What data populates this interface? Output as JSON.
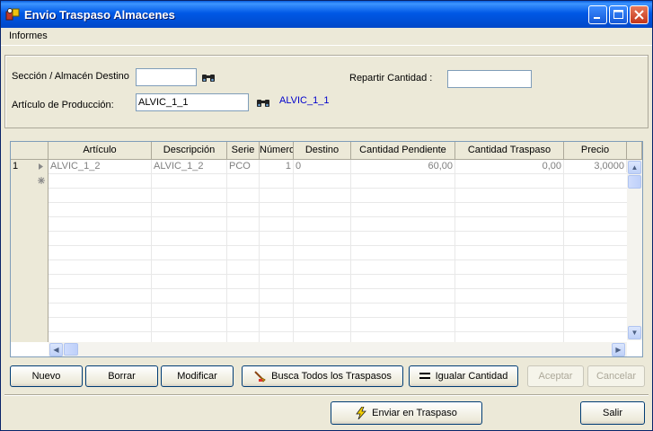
{
  "window": {
    "title": "Envio Traspaso Almacenes"
  },
  "menu": {
    "informes": "Informes"
  },
  "form": {
    "seccion_label": "Sección / Almacén Destino",
    "seccion_value": "",
    "articulo_label": "Artículo de Producción:",
    "articulo_value": "ALVIC_1_1",
    "articulo_link": "ALVIC_1_1",
    "repartir_label": "Repartir Cantidad :",
    "repartir_value": ""
  },
  "grid": {
    "columns": [
      "Artículo",
      "Descripción",
      "Serie",
      "Número",
      "Destino",
      "Cantidad Pendiente",
      "Cantidad Traspaso",
      "Precio"
    ],
    "rows": [
      {
        "num": "1",
        "articulo": "ALVIC_1_2",
        "descripcion": "ALVIC_1_2",
        "serie": "PCO",
        "numero": "1",
        "destino": "0",
        "pendiente": "60,00",
        "traspaso": "0,00",
        "precio": "3,0000"
      }
    ]
  },
  "buttons": {
    "nuevo": "Nuevo",
    "borrar": "Borrar",
    "modificar": "Modificar",
    "busca": "Busca Todos los Traspasos",
    "igualar": "Igualar Cantidad",
    "aceptar": "Aceptar",
    "cancelar": "Cancelar",
    "enviar": "Enviar en Traspaso",
    "salir": "Salir"
  },
  "colors": {
    "titlebar": "#0058e6",
    "link": "#0000cc",
    "window_bg": "#ece9d8"
  }
}
